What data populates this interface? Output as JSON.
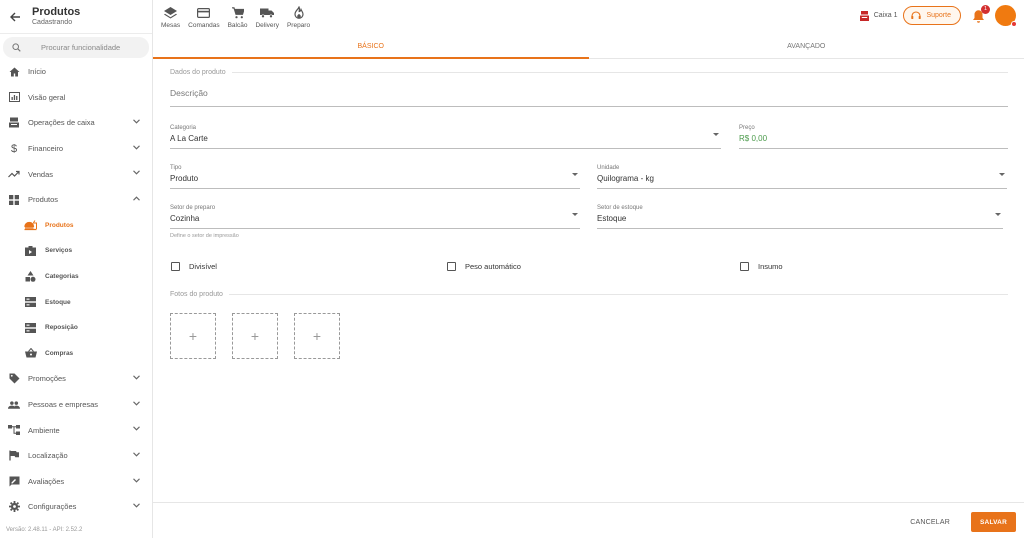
{
  "header": {
    "title": "Produtos",
    "subtitle": "Cadastrando"
  },
  "search": {
    "placeholder": "Procurar funcionalidade"
  },
  "menu": {
    "inicio": "Início",
    "visao_geral": "Visão geral",
    "operacoes": "Operações de caixa",
    "financeiro": "Financeiro",
    "vendas": "Vendas",
    "produtos": "Produtos",
    "sub": {
      "produtos": "Produtos",
      "servicos": "Serviços",
      "categorias": "Categorias",
      "estoque": "Estoque",
      "reposicao": "Reposição",
      "compras": "Compras"
    },
    "promocoes": "Promoções",
    "pessoas": "Pessoas e empresas",
    "ambiente": "Ambiente",
    "localizacao": "Localização",
    "avaliacoes": "Avaliações",
    "configuracoes": "Configurações"
  },
  "version": "Versão: 2.48.11 - API: 2.52.2",
  "quick_actions": {
    "mesas": "Mesas",
    "comandas": "Comandas",
    "balcao": "Balcão",
    "delivery": "Delivery",
    "preparo": "Preparo"
  },
  "topbar": {
    "caixa": "Caixa 1",
    "suporte": "Suporte",
    "notifications": "1"
  },
  "tabs": {
    "basico": "BÁSICO",
    "avancado": "AVANÇADO"
  },
  "form": {
    "section_dados": "Dados do produto",
    "descricao_placeholder": "Descrição",
    "categoria_label": "Categoria",
    "categoria_value": "A La Carte",
    "preco_label": "Preço",
    "preco_value": "R$ 0,00",
    "tipo_label": "Tipo",
    "tipo_value": "Produto",
    "unidade_label": "Unidade",
    "unidade_value": "Quilograma - kg",
    "setor_preparo_label": "Setor de preparo",
    "setor_preparo_value": "Cozinha",
    "setor_preparo_helper": "Define o setor de impressão",
    "setor_estoque_label": "Setor de estoque",
    "setor_estoque_value": "Estoque",
    "divisivel": "Divisível",
    "peso_automatico": "Peso automático",
    "insumo": "Insumo",
    "section_fotos": "Fotos do produto",
    "photo_add": "+"
  },
  "footer": {
    "cancel": "CANCELAR",
    "save": "SALVAR"
  },
  "colors": {
    "accent": "#e8731a",
    "price": "#4a9a4a",
    "badge": "#d32f2f"
  }
}
